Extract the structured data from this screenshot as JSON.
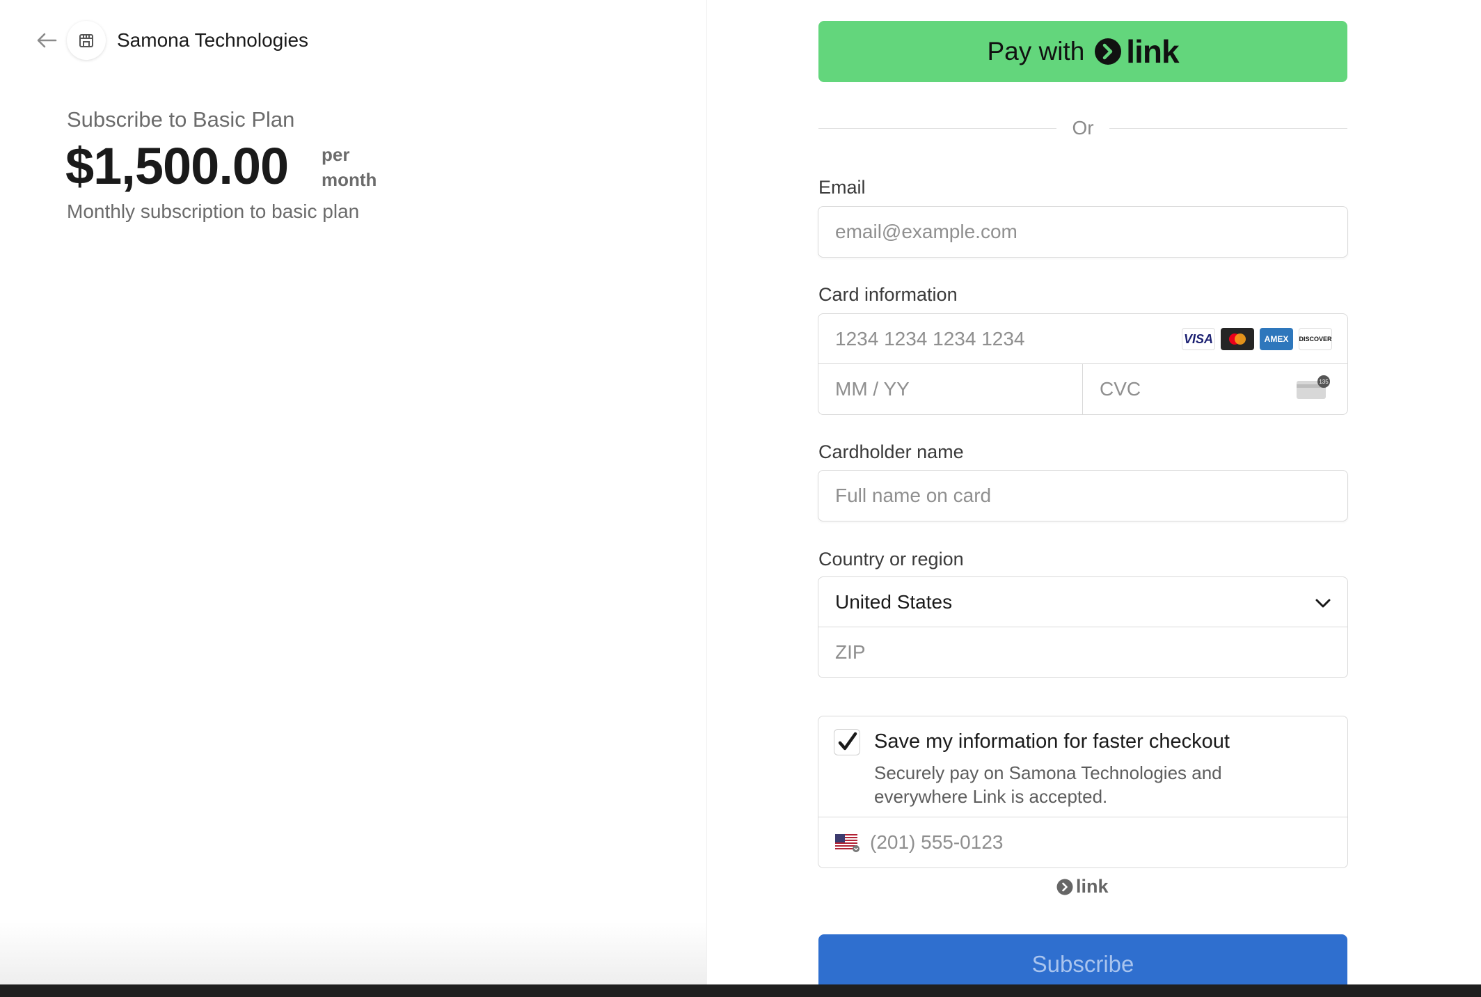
{
  "merchant": {
    "name": "Samona Technologies"
  },
  "product": {
    "title": "Subscribe to Basic Plan",
    "price": "$1,500.00",
    "period_line1": "per",
    "period_line2": "month",
    "description": "Monthly subscription to basic plan"
  },
  "pay_link": {
    "label": "Pay with",
    "brand": "link"
  },
  "divider": {
    "or": "Or"
  },
  "email": {
    "label": "Email",
    "placeholder": "email@example.com"
  },
  "card": {
    "label": "Card information",
    "number_placeholder": "1234 1234 1234 1234",
    "expiry_placeholder": "MM / YY",
    "cvc_placeholder": "CVC",
    "brands": [
      "VISA",
      "Mastercard",
      "AMEX",
      "DISCOVER"
    ],
    "cvc_badge": "135"
  },
  "cardholder": {
    "label": "Cardholder name",
    "placeholder": "Full name on card"
  },
  "country": {
    "label": "Country or region",
    "selected": "United States",
    "zip_placeholder": "ZIP"
  },
  "save_info": {
    "checked": true,
    "title": "Save my information for faster checkout",
    "subtitle": "Securely pay on Samona Technologies and everywhere Link is accepted.",
    "phone_placeholder": "(201) 555-0123"
  },
  "link_footer": {
    "brand": "link"
  },
  "subscribe": {
    "label": "Subscribe"
  },
  "colors": {
    "link_green": "#63d67c",
    "subscribe_blue": "#2f6fcf"
  }
}
